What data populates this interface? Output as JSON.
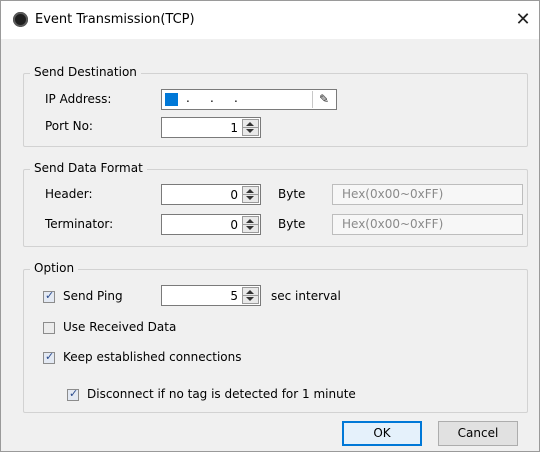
{
  "window": {
    "title": "Event Transmission(TCP)",
    "close_glyph": "✕"
  },
  "send_destination": {
    "legend": "Send Destination",
    "ip_label": "IP Address:",
    "ip_dots": ".",
    "edit_glyph": "✎",
    "port_label": "Port No:",
    "port_value": "1"
  },
  "send_data_format": {
    "legend": "Send Data Format",
    "header_label": "Header:",
    "header_value": "0",
    "header_unit": "Byte",
    "header_hex": "Hex(0x00~0xFF)",
    "terminator_label": "Terminator:",
    "terminator_value": "0",
    "terminator_unit": "Byte",
    "terminator_hex": "Hex(0x00~0xFF)"
  },
  "option": {
    "legend": "Option",
    "send_ping_label": "Send Ping",
    "send_ping_checked": true,
    "ping_value": "5",
    "ping_unit": "sec interval",
    "use_received_label": "Use Received Data",
    "use_received_checked": false,
    "keep_conn_label": "Keep established connections",
    "keep_conn_checked": true,
    "disconnect_label": "Disconnect if no tag is detected for 1 minute",
    "disconnect_checked": true
  },
  "buttons": {
    "ok": "OK",
    "cancel": "Cancel"
  }
}
